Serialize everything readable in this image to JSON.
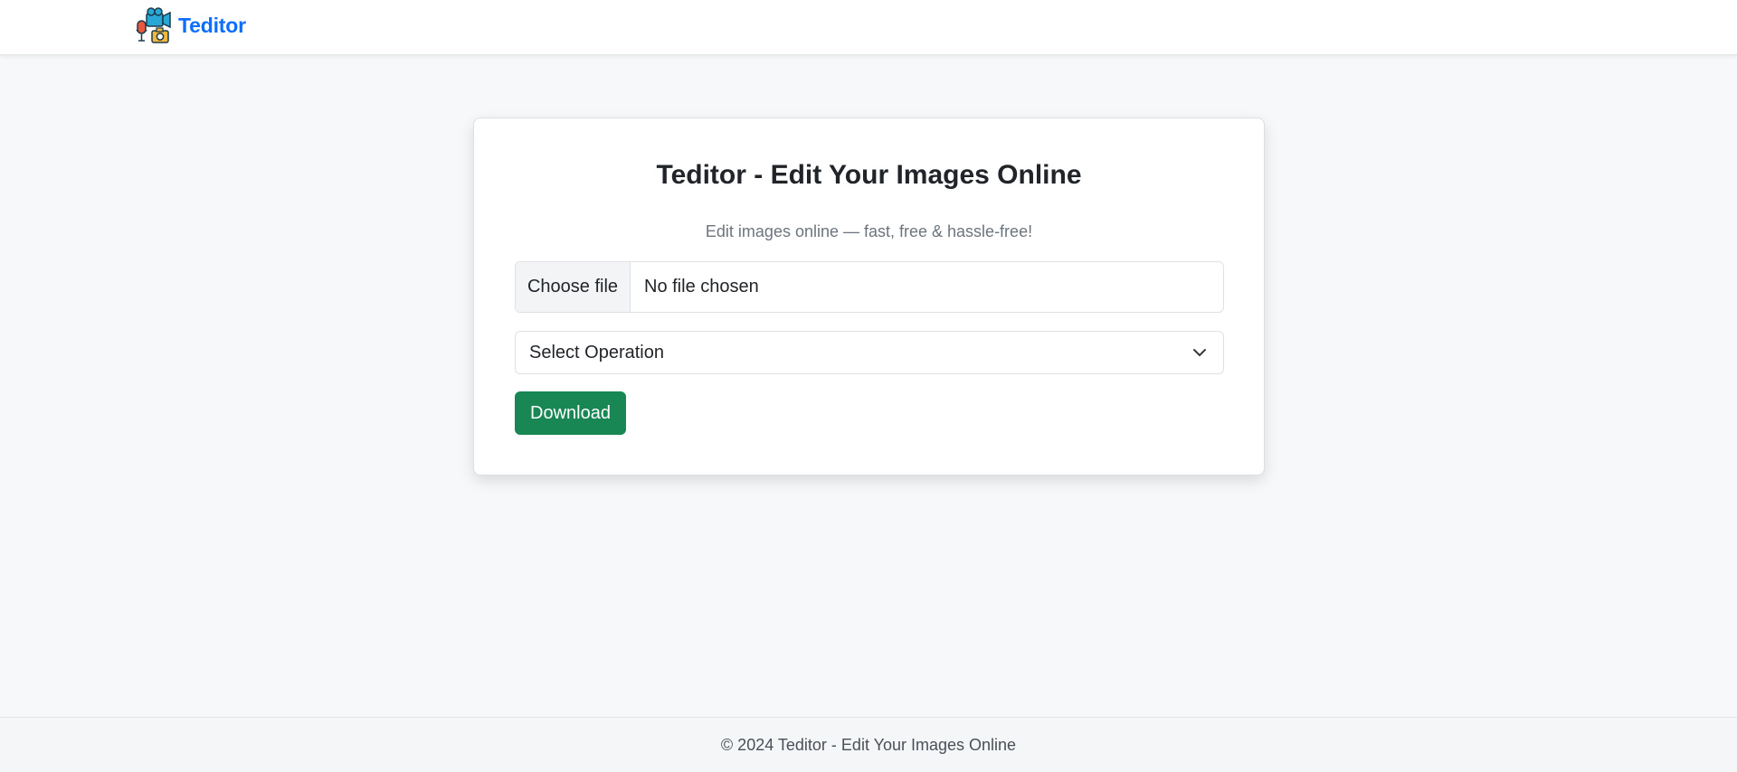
{
  "navbar": {
    "brand_name": "Teditor",
    "brand_logo_icon": "camera-microphone-logo-icon",
    "brand_color": "#0d6efd"
  },
  "card": {
    "title": "Teditor - Edit Your Images Online",
    "subtitle": "Edit images online — fast, free & hassle-free!",
    "file_input": {
      "button_label": "Choose file",
      "status_text": "No file chosen"
    },
    "operation_select": {
      "selected_label": "Select Operation",
      "icon": "chevron-down-icon"
    },
    "download_button": {
      "label": "Download",
      "color": "#198754"
    }
  },
  "footer": {
    "text": "© 2024 Teditor - Edit Your Images Online"
  }
}
